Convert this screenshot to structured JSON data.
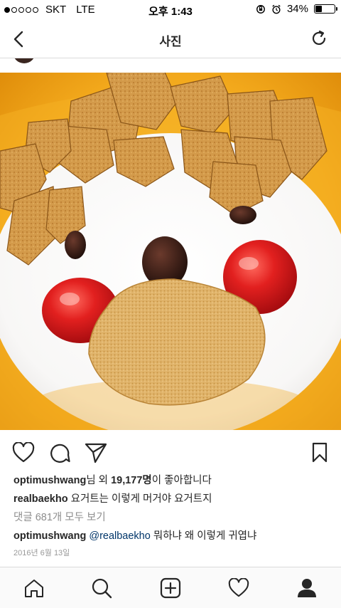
{
  "status_bar": {
    "carrier": "SKT",
    "network": "LTE",
    "time": "오후 1:43",
    "battery_percent": "34%",
    "battery_level": 0.34,
    "signal_dots_filled": 1
  },
  "header": {
    "title": "사진",
    "back_icon": "chevron-left-icon",
    "refresh_icon": "refresh-icon"
  },
  "photo": {
    "description_icon": "yogurt-bowl-face-photo"
  },
  "actions": {
    "like_icon": "heart-outline-icon",
    "comment_icon": "comment-icon",
    "share_icon": "paper-plane-icon",
    "save_icon": "bookmark-icon"
  },
  "likes": {
    "user": "optimushwang",
    "middle": "님 외 ",
    "count": "19,177명",
    "suffix": "이 좋아합니다"
  },
  "caption": {
    "user": "realbaekho",
    "text": "요거트는 이렇게 머거야 요거트지"
  },
  "view_comments": "댓글 681개 모두 보기",
  "comment": {
    "user": "optimushwang",
    "mention": "@realbaekho",
    "text": "뭐하냐 왜 이렇게 귀엽냐"
  },
  "date": "2016년 6월 13일",
  "tabbar": {
    "items": [
      "home-icon",
      "search-icon",
      "add-post-icon",
      "activity-heart-icon",
      "profile-icon"
    ]
  },
  "colors": {
    "bowl_yellow": "#f2a81a",
    "yogurt": "#fbfbfb",
    "cherry": "#d81e1e",
    "flake": "#c98b3c",
    "mention": "#003569"
  }
}
